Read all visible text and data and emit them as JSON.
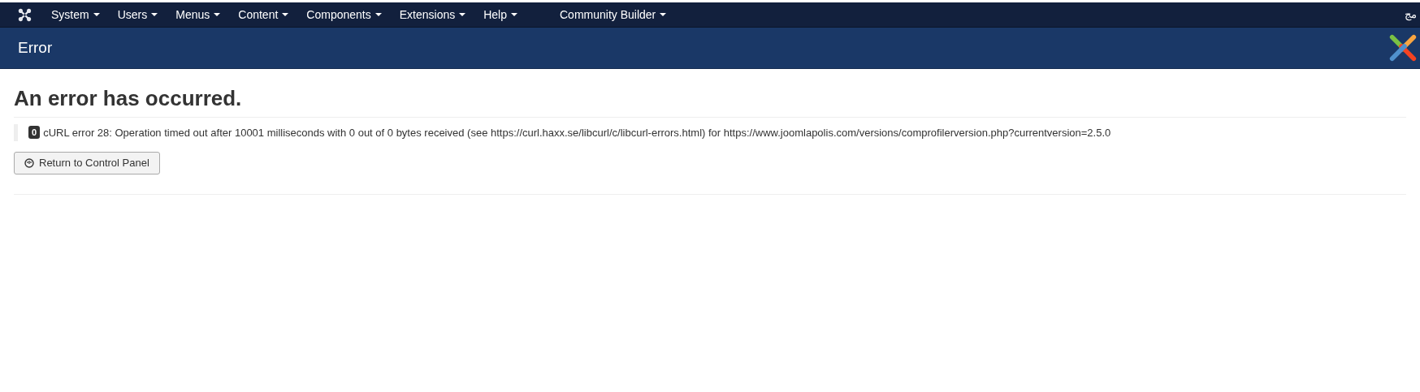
{
  "navbar": {
    "menus": [
      {
        "label": "System"
      },
      {
        "label": "Users"
      },
      {
        "label": "Menus"
      },
      {
        "label": "Content"
      },
      {
        "label": "Components"
      },
      {
        "label": "Extensions"
      },
      {
        "label": "Help"
      },
      {
        "label": "Community Builder"
      }
    ],
    "user_menu": "مج"
  },
  "header": {
    "title": "Error"
  },
  "error": {
    "heading": "An error has occurred.",
    "code": "0",
    "message": "cURL error 28: Operation timed out after 10001 milliseconds with 0 out of 0 bytes received (see https://curl.haxx.se/libcurl/c/libcurl-errors.html) for https://www.joomlapolis.com/versions/comprofilerversion.php?currentversion=2.5.0",
    "button": "Return to Control Panel"
  }
}
